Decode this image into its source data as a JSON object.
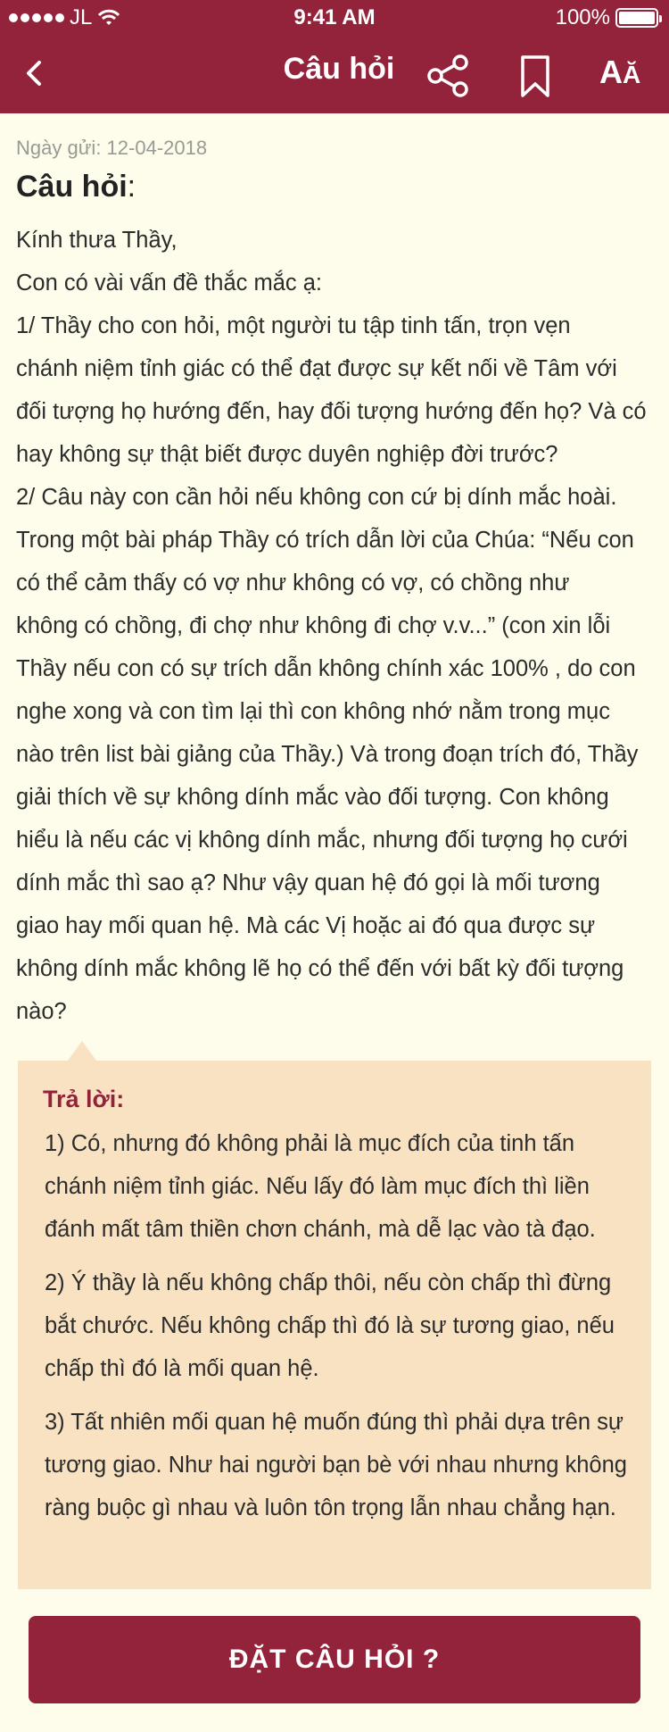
{
  "status_bar": {
    "carrier": "JL",
    "time": "9:41 AM",
    "battery": "100%"
  },
  "nav": {
    "title": "Câu hỏi",
    "font_icon_text_big": "A",
    "font_icon_text_small": "Ă"
  },
  "question": {
    "date": "Ngày gửi: 12-04-2018",
    "heading": "Câu hỏi",
    "heading_suffix": ":",
    "lines": [
      "Kính thưa Thầy,",
      "Con có vài vấn đề thắc mắc ạ:",
      "1/ Thầy cho con hỏi, một người tu tập tinh tấn, trọn vẹn",
      "chánh niệm tỉnh giác có thể đạt được sự kết nối về Tâm với",
      "đối tượng họ hướng đến, hay đối tượng hướng đến họ? Và có",
      "hay không sự thật biết được duyên nghiệp đời trước?",
      "2/ Câu này con cần hỏi nếu không con cứ bị dính mắc hoài.",
      "Trong một bài pháp Thầy có trích dẫn lời của Chúa: “Nếu con",
      "có thể cảm thấy có vợ như không có vợ, có chồng như",
      "không có chồng, đi chợ như không đi chợ v.v...” (con xin lỗi",
      "Thầy nếu con có sự trích dẫn không chính xác 100% , do con",
      "nghe xong và con tìm lại thì con không nhớ nằm trong mục",
      "nào trên list bài giảng của Thầy.) Và trong đoạn trích đó, Thầy",
      "giải thích về sự không dính mắc vào đối tượng. Con không",
      "hiểu là nếu các vị không dính mắc, nhưng đối tượng họ cưới",
      "dính mắc thì sao ạ? Như vậy quan hệ đó gọi là mối tương",
      "giao hay mối quan hệ. Mà các Vị hoặc ai đó qua được sự",
      "không dính mắc không lẽ họ có thể đến với bất kỳ đối tượng",
      "nào?"
    ]
  },
  "answer": {
    "title": "Trả lời:",
    "paragraphs": [
      "1) Có, nhưng đó không phải là mục đích của tinh tấn chánh niệm tỉnh giác. Nếu lấy đó làm mục đích thì liền đánh mất tâm thiền chơn chánh, mà dễ lạc vào tà đạo.",
      "2) Ý thầy là nếu không chấp thôi, nếu còn chấp thì đừng bắt chước. Nếu không chấp thì đó là sự tương giao, nếu chấp thì đó là mối quan hệ.",
      "3) Tất nhiên mối quan hệ muốn đúng thì phải dựa trên sự tương giao. Như hai người bạn bè với nhau nhưng không ràng buộc gì nhau và luôn tôn trọng lẫn nhau chẳng hạn."
    ]
  },
  "ask_button": {
    "label": "ĐẶT CÂU HỎI ?"
  },
  "colors": {
    "primary": "#93233B",
    "background": "#FEFCEB",
    "answer_bg": "#F8E2C2"
  }
}
